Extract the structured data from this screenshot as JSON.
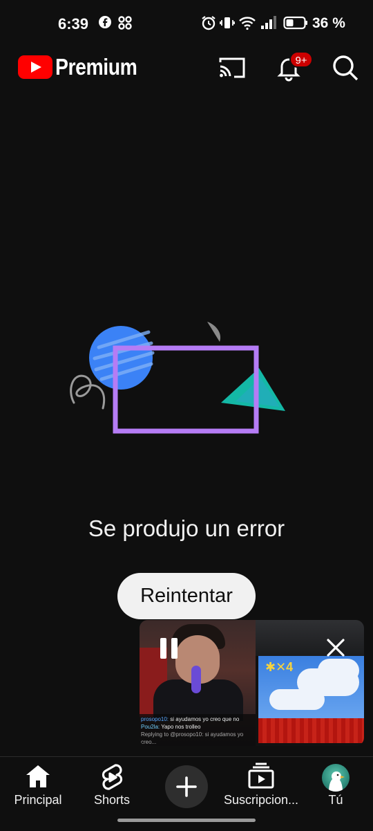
{
  "status_bar": {
    "time": "6:39",
    "battery_text": "36 %",
    "icons": [
      "facebook-icon",
      "pinwheel-icon",
      "alarm-icon",
      "vibrate-icon",
      "wifi-icon",
      "signal-icon",
      "battery-icon"
    ]
  },
  "header": {
    "logo_text": "Premium",
    "notification_badge": "9+",
    "icons": [
      "cast-icon",
      "bell-icon",
      "search-icon"
    ]
  },
  "main": {
    "error_message": "Se produjo un error",
    "retry_label": "Reintentar"
  },
  "mini_player": {
    "chat_lines": [
      {
        "user": "prosopo10:",
        "text": "si ayudamos yo creo que no"
      },
      {
        "user": "Pou2la:",
        "text": "Yapo nos trolleo"
      },
      {
        "user": "",
        "text": "Replying to @prosopo10: si ayudamos yo creo..."
      }
    ],
    "game_hud": "✱✕4"
  },
  "bottom_nav": {
    "items": [
      {
        "label": "Principal",
        "icon": "home-icon"
      },
      {
        "label": "Shorts",
        "icon": "shorts-icon"
      },
      {
        "label": "",
        "icon": "create-plus-icon"
      },
      {
        "label": "Suscripcion...",
        "icon": "subscriptions-icon"
      },
      {
        "label": "Tú",
        "icon": "avatar"
      }
    ]
  },
  "colors": {
    "background": "#0f0f0f",
    "brand_red": "#ff0000",
    "badge_red": "#cc0000",
    "illus_blue": "#3b82f6",
    "illus_purple": "#b57cf5",
    "illus_teal": "#14b8a6",
    "button_bg": "#f1f1f1"
  }
}
